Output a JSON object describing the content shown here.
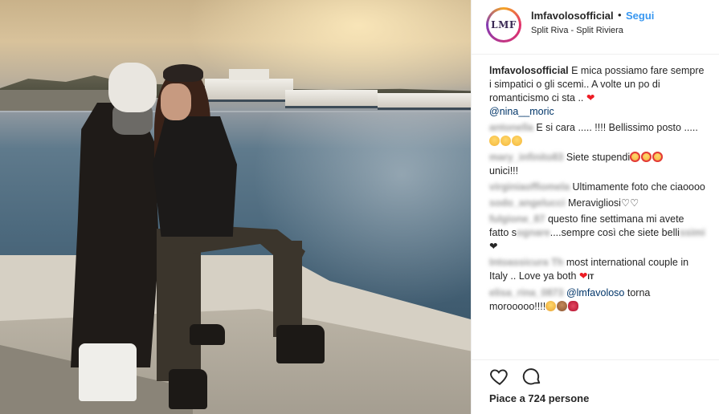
{
  "header": {
    "avatar_text": "LMF",
    "username": "lmfavolosofficial",
    "separator": "•",
    "follow_label": "Segui",
    "location": "Split Riva - Split Riviera"
  },
  "caption": {
    "username": "lmfavolosofficial",
    "text": "E mica possiamo fare sempre i simpatici o gli scemi.. A volte un po di romanticismo ci sta ..",
    "mention": "@nina__moric"
  },
  "comments": [
    {
      "username": "antonella",
      "text": "E si cara ..... !!!! Bellissimo posto .....",
      "emoji": [
        "smile-icon",
        "smile-icon",
        "smile-icon"
      ]
    },
    {
      "username": "mary_infinito83",
      "text": "Siete stupendi",
      "emoji": [
        "heart-eyes-icon",
        "heart-eyes-icon",
        "heart-eyes-icon"
      ],
      "text2": "unici!!!"
    },
    {
      "username": "virginiaoffiomela",
      "text": "Ultimamente foto che ciaoooo"
    },
    {
      "username": "sodo_angelucci",
      "text": "Meravigliosi♡♡"
    },
    {
      "username": "fulgione_87",
      "text": "questo fine settimana mi avete fatto s",
      "blur_mid": "ognare",
      "text2": "....sempre così che siete belli",
      "blur_end": "ssimi"
    },
    {
      "username": "Intoassicura Th",
      "text": "most international couple in Italy .. Love ya both",
      "suffix": "IT"
    },
    {
      "username": "elisa_rina_0873",
      "mention": "@lmfavoloso",
      "text": "torna morooooo!!!!"
    }
  ],
  "likes_text": "Piace a 724 persone",
  "colors": {
    "accent": "#3897f0",
    "text": "#262626",
    "heart": "#ed1c24"
  }
}
